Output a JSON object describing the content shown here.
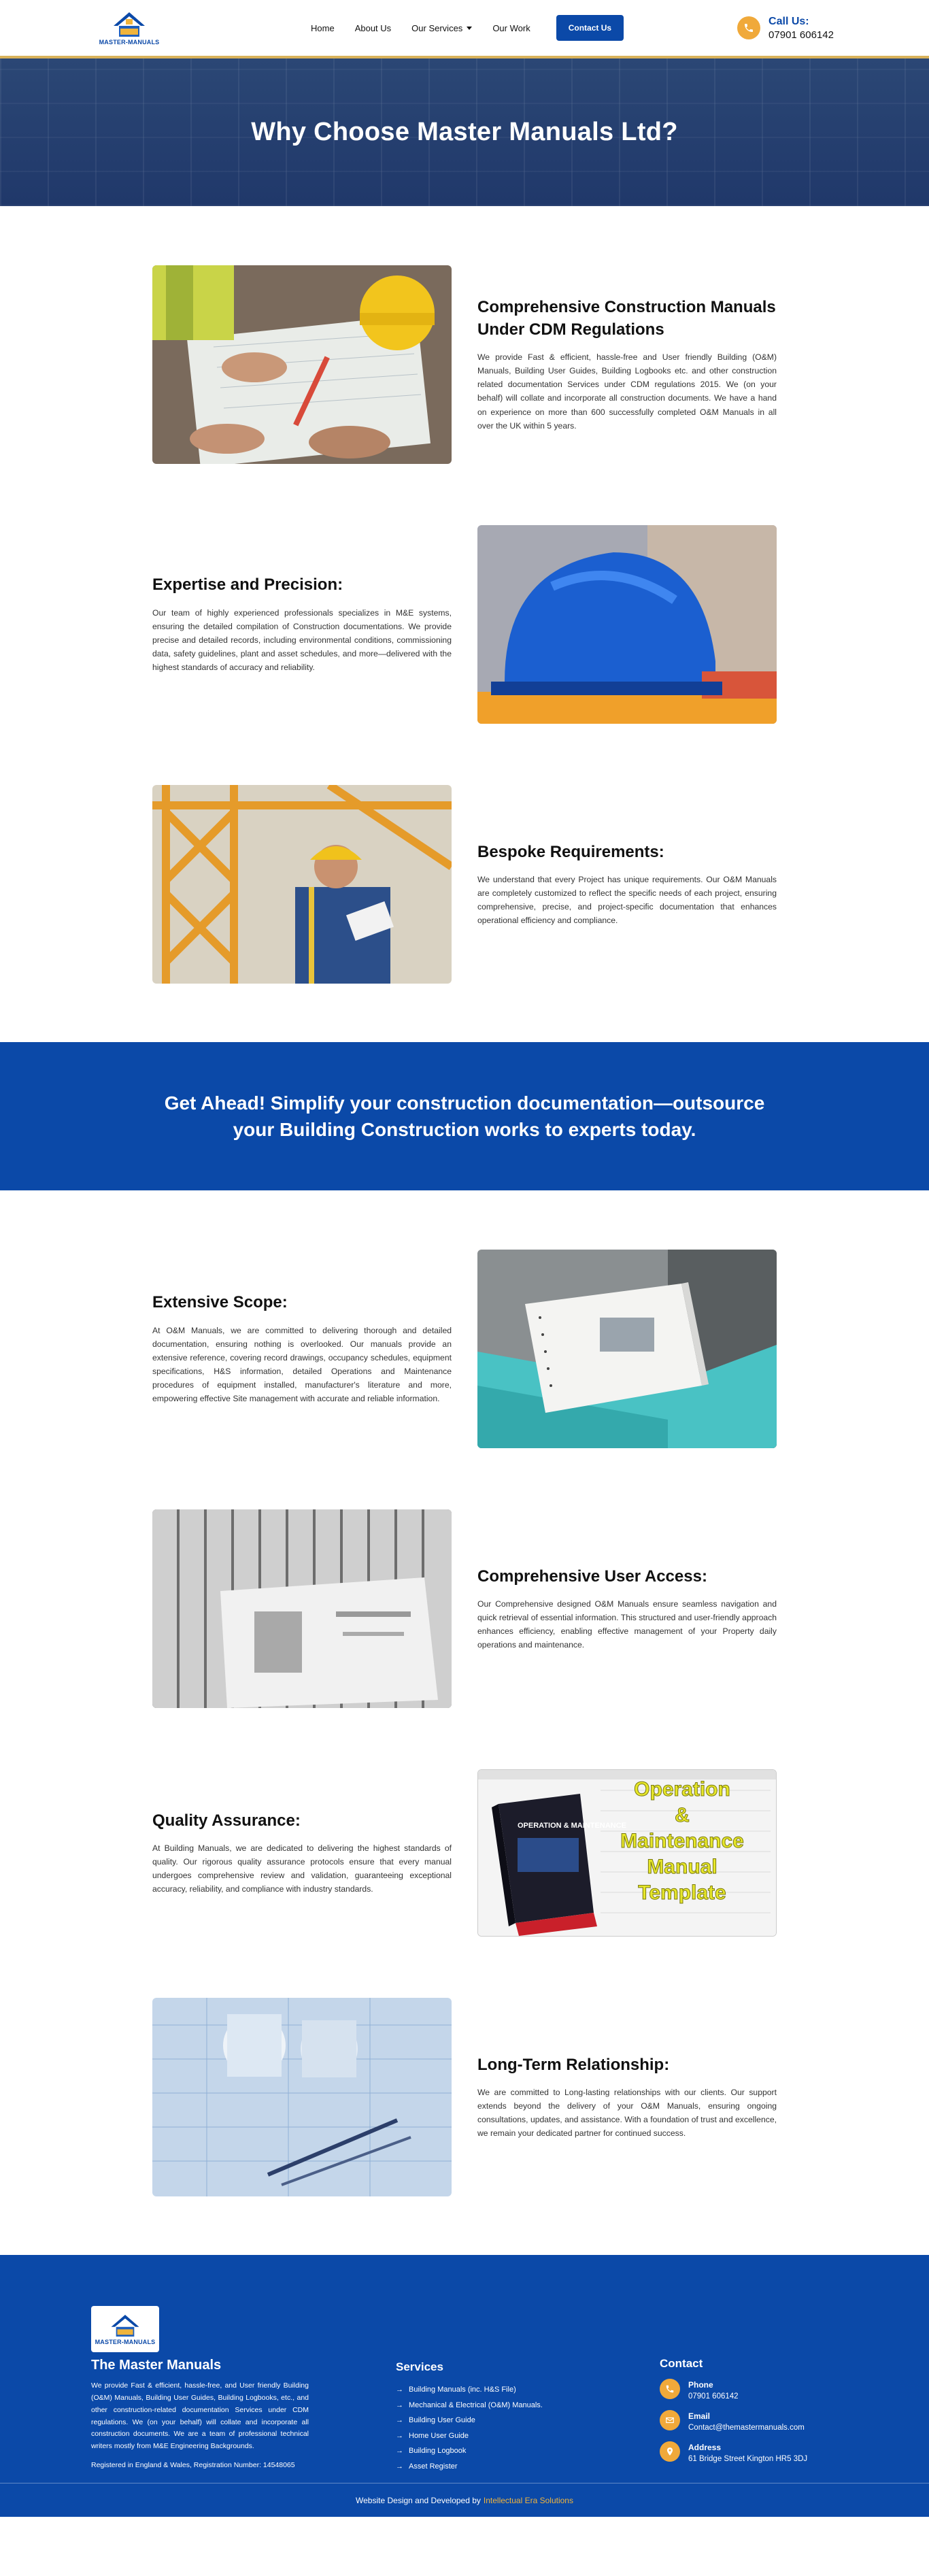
{
  "header": {
    "logo_text": "MASTER-MANUALS",
    "nav": [
      {
        "label": "Home"
      },
      {
        "label": "About Us"
      },
      {
        "label": "Our Services"
      },
      {
        "label": "Our Work"
      }
    ],
    "contact_button": "Contact Us",
    "call_label": "Call Us:",
    "call_number": "07901 606142"
  },
  "hero": {
    "title": "Why Choose Master Manuals Ltd?"
  },
  "features": [
    {
      "title": "Comprehensive Construction Manuals Under CDM Regulations",
      "body": "We provide Fast & efficient, hassle-free and User friendly Building (O&M) Manuals, Building User Guides, Building Logbooks etc. and other construction related documentation Services under CDM regulations 2015. We (on your behalf) will collate and incorporate all construction documents. We have a hand on experience on more than 600 successfully completed O&M Manuals in all over the UK within 5 years."
    },
    {
      "title": "Expertise and Precision:",
      "body": "Our team of highly experienced professionals specializes in M&E systems, ensuring the detailed compilation of Construction documentations. We provide precise and detailed records, including environmental conditions, commissioning data, safety guidelines, plant and asset schedules, and more—delivered with the highest standards of accuracy and reliability."
    },
    {
      "title": "Bespoke Requirements:",
      "body": "We understand that every Project has unique requirements. Our O&M Manuals are completely customized to reflect the specific needs of each project, ensuring comprehensive, precise, and project-specific documentation that enhances operational efficiency and compliance."
    }
  ],
  "cta": {
    "text": "Get Ahead! Simplify your construction documentation—outsource your Building Construction works to experts today."
  },
  "features2": [
    {
      "title": "Extensive Scope:",
      "body": "At O&M Manuals, we are committed to delivering thorough and detailed documentation, ensuring nothing is overlooked. Our manuals provide an extensive reference, covering record drawings, occupancy schedules, equipment specifications, H&S information, detailed Operations and Maintenance procedures of equipment installed, manufacturer's literature and more, empowering effective Site management with accurate and reliable information."
    },
    {
      "title": "Comprehensive User Access:",
      "body": "Our Comprehensive designed O&M Manuals ensure seamless navigation and quick retrieval of essential information. This structured and user-friendly approach enhances efficiency, enabling effective management of your Property daily operations and maintenance."
    },
    {
      "title": "Quality Assurance:",
      "body": "At Building Manuals, we are dedicated to delivering the highest standards of quality. Our rigorous quality assurance protocols ensure that every manual undergoes comprehensive review and validation, guaranteeing exceptional accuracy, reliability, and compliance with industry standards.",
      "image_book_title": "OPERATION & MAINTENANCE",
      "image_overlay": [
        "Operation",
        "&",
        "Maintenance",
        "Manual",
        "Template"
      ]
    },
    {
      "title": "Long-Term Relationship:",
      "body": "We are committed to Long-lasting relationships with our clients. Our support extends beyond the delivery of your O&M Manuals, ensuring ongoing consultations, updates, and assistance. With a foundation of trust and excellence, we remain your dedicated partner for continued success."
    }
  ],
  "footer": {
    "title": "The Master Manuals",
    "description": "We provide Fast & efficient, hassle-free, and User friendly Building (O&M) Manuals, Building User Guides, Building Logbooks, etc., and other construction-related documentation Services under CDM regulations. We (on your behalf) will collate and incorporate all construction documents. We are a team of professional technical writers mostly from M&E Engineering Backgrounds.",
    "registration": "Registered in England & Wales, Registration Number: 14548065",
    "services_heading": "Services",
    "services": [
      "Building Manuals (inc. H&S File)",
      "Mechanical & Electrical (O&M) Manuals.",
      "Building User Guide",
      "Home User Guide",
      "Building Logbook",
      "Asset Register"
    ],
    "contact_heading": "Contact",
    "phone_label": "Phone",
    "phone": "07901 606142",
    "email_label": "Email",
    "email": "Contact@themastermanuals.com",
    "address_label": "Address",
    "address": "61 Bridge Street Kington HR5 3DJ",
    "credit_prefix": "Website Design and Developed by",
    "credit_company": "Intellectual Era Solutions"
  },
  "colors": {
    "brand_blue": "#0b49a8",
    "accent_orange": "#f0a93a",
    "header_border": "#d8b25a"
  }
}
